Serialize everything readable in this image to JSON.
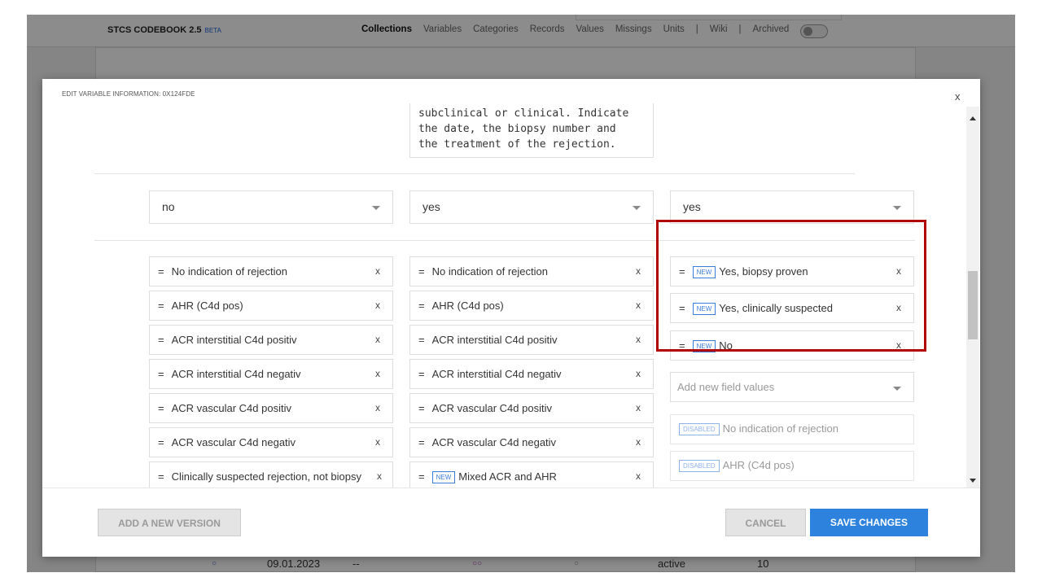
{
  "nav": {
    "brand": "STCS CODEBOOK 2.5",
    "beta": "BETA",
    "links": [
      "Collections",
      "Variables",
      "Categories",
      "Records",
      "Values",
      "Missings",
      "Units"
    ],
    "sep1": "|",
    "wiki": "Wiki",
    "sep2": "|",
    "archived": "Archived"
  },
  "background_row": {
    "date": "09.01.2023",
    "dash": "--",
    "status": "active",
    "count": "10"
  },
  "modal": {
    "title": "EDIT VARIABLE INFORMATION: 0X124FDE",
    "close": "x",
    "description_text": "subclinical or clinical. Indicate\nthe date, the biopsy number and\nthe treatment of the rejection.",
    "dropdowns": [
      "no",
      "yes",
      "yes"
    ],
    "col1": [
      {
        "eq": "=",
        "label": "No indication of rejection",
        "x": "x"
      },
      {
        "eq": "=",
        "label": "AHR (C4d pos)",
        "x": "x"
      },
      {
        "eq": "=",
        "label": "ACR interstitial C4d positiv",
        "x": "x"
      },
      {
        "eq": "=",
        "label": "ACR interstitial C4d negativ",
        "x": "x"
      },
      {
        "eq": "=",
        "label": "ACR vascular C4d positiv",
        "x": "x"
      },
      {
        "eq": "=",
        "label": "ACR vascular C4d negativ",
        "x": "x"
      },
      {
        "eq": "=",
        "label": "Clinically suspected rejection, not biopsy",
        "x": "x"
      }
    ],
    "col2": [
      {
        "eq": "=",
        "label": "No indication of rejection",
        "x": "x"
      },
      {
        "eq": "=",
        "label": "AHR (C4d pos)",
        "x": "x"
      },
      {
        "eq": "=",
        "label": "ACR interstitial C4d positiv",
        "x": "x"
      },
      {
        "eq": "=",
        "label": "ACR interstitial C4d negativ",
        "x": "x"
      },
      {
        "eq": "=",
        "label": "ACR vascular C4d positiv",
        "x": "x"
      },
      {
        "eq": "=",
        "label": "ACR vascular C4d negativ",
        "x": "x"
      },
      {
        "eq": "=",
        "badge": "NEW",
        "label": "Mixed ACR and AHR",
        "x": "x"
      }
    ],
    "col3_new": [
      {
        "eq": "=",
        "badge": "NEW",
        "label": "Yes, biopsy proven",
        "x": "x"
      },
      {
        "eq": "=",
        "badge": "NEW",
        "label": "Yes, clinically suspected",
        "x": "x"
      },
      {
        "eq": "=",
        "badge": "NEW",
        "label": "No",
        "x": "x"
      }
    ],
    "add_placeholder": "Add new field values",
    "col3_disabled": [
      {
        "badge": "DISABLED",
        "label": "No indication of rejection"
      },
      {
        "badge": "DISABLED",
        "label": "AHR (C4d pos)"
      }
    ],
    "buttons": {
      "add_version": "ADD A NEW VERSION",
      "cancel": "CANCEL",
      "save": "SAVE CHANGES"
    }
  },
  "colors": {
    "highlight": "#b00000",
    "primary": "#2c82dc",
    "badge": "#3b7ddd"
  }
}
